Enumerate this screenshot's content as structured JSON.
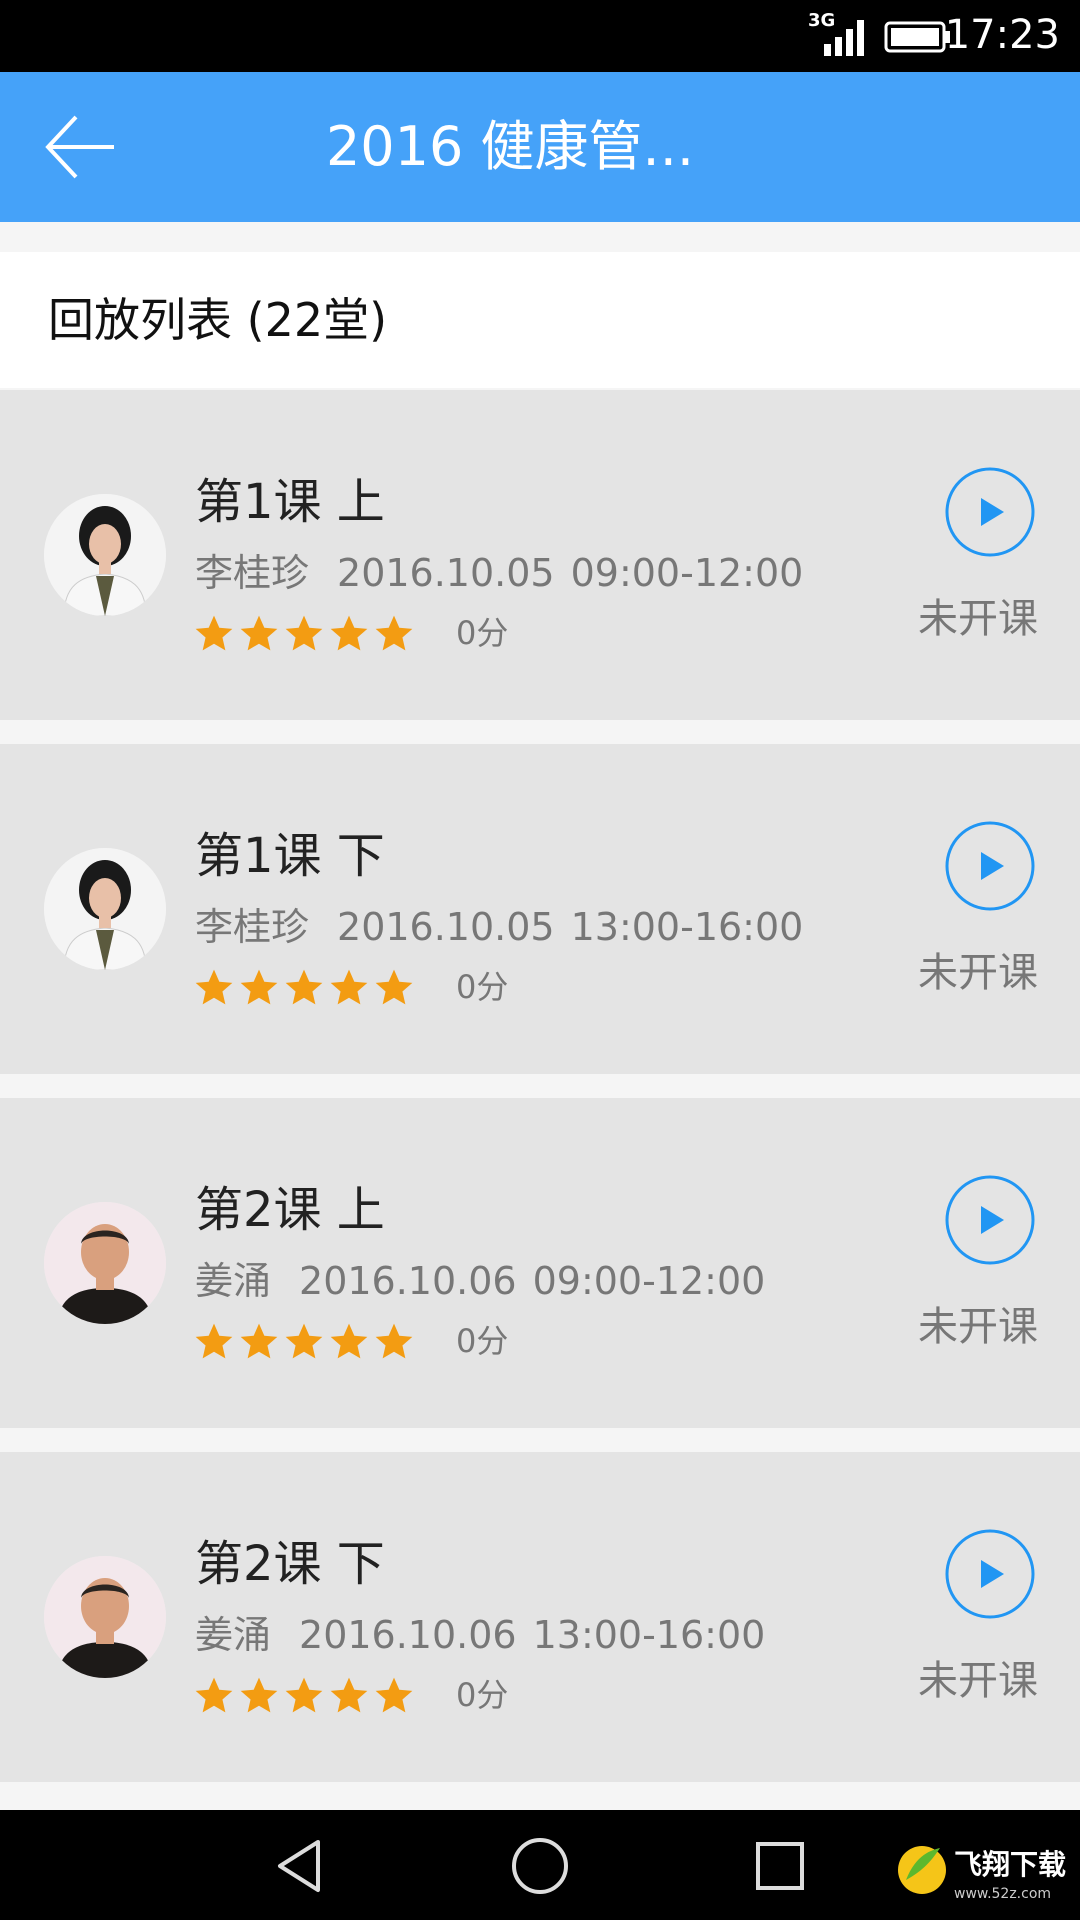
{
  "status_bar": {
    "network": "3G",
    "time": "17:23"
  },
  "header": {
    "title": "2016 健康管..."
  },
  "section": {
    "title": "回放列表",
    "count": "(22堂)"
  },
  "lessons": [
    {
      "title": "第1课 上",
      "teacher": "李桂珍",
      "date": "2016.10.05",
      "time": "09:00-12:00",
      "rating_stars": 5,
      "score": "0分",
      "status": "未开课",
      "avatar": "female-teacher"
    },
    {
      "title": "第1课 下",
      "teacher": "李桂珍",
      "date": "2016.10.05",
      "time": "13:00-16:00",
      "rating_stars": 5,
      "score": "0分",
      "status": "未开课",
      "avatar": "female-teacher"
    },
    {
      "title": "第2课 上",
      "teacher": "姜涌",
      "date": "2016.10.06",
      "time": "09:00-12:00",
      "rating_stars": 5,
      "score": "0分",
      "status": "未开课",
      "avatar": "male-teacher"
    },
    {
      "title": "第2课 下",
      "teacher": "姜涌",
      "date": "2016.10.06",
      "time": "13:00-16:00",
      "rating_stars": 5,
      "score": "0分",
      "status": "未开课",
      "avatar": "male-teacher"
    }
  ],
  "colors": {
    "accent": "#45a2f9",
    "star": "#f39c12",
    "play": "#2196f3"
  },
  "watermark": {
    "text": "飞翔下载",
    "url": "www.52z.com"
  }
}
